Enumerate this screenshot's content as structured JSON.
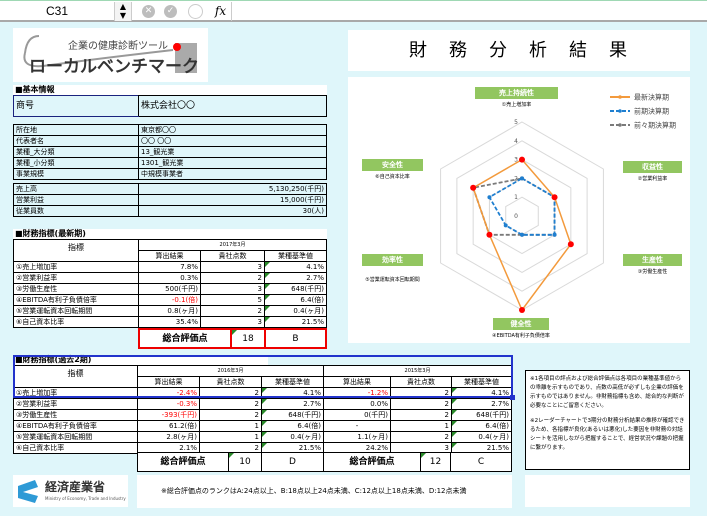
{
  "excel": {
    "name_box": "C31",
    "fx_label": "fx"
  },
  "logo": {
    "subtitle": "企業の健康診断ツール",
    "title": "ローカルベンチマーク"
  },
  "basic": {
    "heading": "■基本情報",
    "company_label": "商号",
    "company_value": "株式会社〇〇",
    "rows": [
      [
        "所在地",
        "東京都〇〇"
      ],
      [
        "代表者名",
        "〇〇 〇〇"
      ],
      [
        "業種_大分類",
        "13_観光業"
      ],
      [
        "業種_小分類",
        "1301_観光業"
      ],
      [
        "事業規模",
        "中規模事業者"
      ]
    ],
    "figures": [
      [
        "売上高",
        "5,130,250(千円)"
      ],
      [
        "営業利益",
        "15,000(千円)"
      ],
      [
        "従業員数",
        "30(人)"
      ]
    ]
  },
  "latest": {
    "heading": "■財務指標(最新期)",
    "indicator_header": "指標",
    "period": "2017年3月",
    "cols": [
      "算出結果",
      "貴社点数",
      "業種基準値"
    ],
    "rows": [
      [
        "①売上増加率",
        "7.8%",
        "3",
        "4.1%"
      ],
      [
        "②営業利益率",
        "0.3%",
        "2",
        "2.7%"
      ],
      [
        "③労働生産性",
        "500(千円)",
        "3",
        "648(千円)"
      ],
      [
        "④EBITDA有利子負債倍率",
        "-0.1(倍)",
        "5",
        "6.4(倍)"
      ],
      [
        "⑤営業運転資本回転期間",
        "0.8(ヶ月)",
        "2",
        "0.4(ヶ月)"
      ],
      [
        "⑥自己資本比率",
        "35.4%",
        "3",
        "21.5%"
      ]
    ],
    "negative": [
      [
        3
      ]
    ],
    "total_label": "総合評価点",
    "total": "18",
    "rank": "B"
  },
  "past": {
    "heading": "■財務指標(過去2期)",
    "indicator_header": "指標",
    "periods": [
      "2016年3月",
      "2015年3月"
    ],
    "cols": [
      "算出結果",
      "貴社点数",
      "業種基準値"
    ],
    "rows": [
      [
        "①売上増加率",
        "-2.4%",
        "2",
        "4.1%",
        "-1.2%",
        "2",
        "4.1%"
      ],
      [
        "②営業利益率",
        "-0.3%",
        "2",
        "2.7%",
        "0.0%",
        "2",
        "2.7%"
      ],
      [
        "③労働生産性",
        "-393(千円)",
        "2",
        "648(千円)",
        "0(千円)",
        "2",
        "648(千円)"
      ],
      [
        "④EBITDA有利子負債倍率",
        "61.2(倍)",
        "1",
        "6.4(倍)",
        "-",
        "1",
        "6.4(倍)"
      ],
      [
        "⑤営業運転資本回転期間",
        "2.8(ヶ月)",
        "1",
        "0.4(ヶ月)",
        "1.1(ヶ月)",
        "2",
        "0.4(ヶ月)"
      ],
      [
        "⑥自己資本比率",
        "2.1%",
        "2",
        "21.5%",
        "24.2%",
        "3",
        "21.5%"
      ]
    ],
    "total_label": "総合評価点",
    "totals": [
      [
        "10",
        "D"
      ],
      [
        "12",
        "C"
      ]
    ]
  },
  "result_title": "財　務　分　析　結　果",
  "chart_data": {
    "type": "radar",
    "rmin": 0,
    "rmax": 5,
    "ticks": [
      "0",
      "1",
      "2",
      "3",
      "4",
      "5"
    ],
    "axes": [
      {
        "name": "売上持続性",
        "sub": "①売上増加率"
      },
      {
        "name": "収益性",
        "sub": "②営業利益率"
      },
      {
        "name": "生産性",
        "sub": "③労働生産性"
      },
      {
        "name": "健全性",
        "sub": "④EBITDA有利子負債倍率"
      },
      {
        "name": "効率性",
        "sub": "⑤営業運転資本回転期間"
      },
      {
        "name": "安全性",
        "sub": "⑥自己資本比率"
      }
    ],
    "series": [
      {
        "name": "最新決算期",
        "values": [
          3,
          2,
          3,
          5,
          2,
          3
        ],
        "color": "#f39a3c",
        "marker": "#ff0000",
        "dash": false
      },
      {
        "name": "前期決算期",
        "values": [
          2,
          2,
          2,
          1,
          1,
          2
        ],
        "color": "#1f7fd0",
        "dash": true
      },
      {
        "name": "前々期決算期",
        "values": [
          2,
          2,
          2,
          1,
          2,
          3
        ],
        "color": "#7a7a7a",
        "dash": true
      }
    ],
    "legend": "top-right"
  },
  "notes": [
    "※1各項目の評点および総合評価点は各項目の業種基準値からの乖離を示すものであり、点数の高低が必ずしも企業の評価を示すものではありません。非財務指標も含め、総合的な判断が必要なことにご留意ください。",
    "※2レーダーチャートで3期分の財務分析結果の推移が確認できるため、各指標が良化(あるいは悪化)した要因を非財務の対話シートを活用しながら把握することで、経営状況や課題の把握に繋がります。"
  ],
  "footnote": "※総合評価点のランクはA:24点以上、B:18点以上24点未満、C:12点以上18点未満、D:12点未満",
  "meti": {
    "name": "経済産業省",
    "en": "Ministry of Economy, Trade and Industry"
  }
}
